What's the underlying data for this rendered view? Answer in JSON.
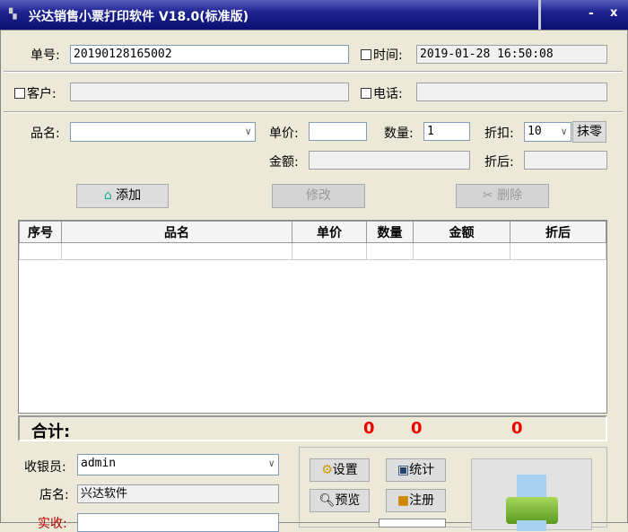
{
  "window": {
    "title": "兴达销售小票打印软件 V18.0(标准版)",
    "minimize": "-",
    "close": "x"
  },
  "order": {
    "no_label": "单号:",
    "no_value": "20190128165002",
    "time_label": "时间:",
    "time_value": "2019-01-28 16:50:08",
    "customer_label": "客户:",
    "customer_value": "",
    "phone_label": "电话:",
    "phone_value": ""
  },
  "item": {
    "name_label": "品名:",
    "name_value": "",
    "price_label": "单价:",
    "price_value": "",
    "qty_label": "数量:",
    "qty_value": "1",
    "discount_label": "折扣:",
    "discount_value": "10",
    "round_button": "抹零",
    "amount_label": "金额:",
    "amount_value": "",
    "after_label": "折后:",
    "after_value": ""
  },
  "actions": {
    "add": "添加",
    "edit": "修改",
    "delete": "删除"
  },
  "table": {
    "headers": [
      "序号",
      "品名",
      "单价",
      "数量",
      "金额",
      "折后"
    ]
  },
  "totals": {
    "label": "合计:",
    "qty": "0",
    "amount": "0",
    "after": "0"
  },
  "bottom": {
    "cashier_label": "收银员:",
    "cashier_value": "admin",
    "shop_label": "店名:",
    "shop_value": "兴达软件",
    "received_label": "实收:",
    "received_value": ""
  },
  "tools": {
    "settings": "设置",
    "stats": "统计",
    "preview": "预览",
    "register": "注册"
  }
}
